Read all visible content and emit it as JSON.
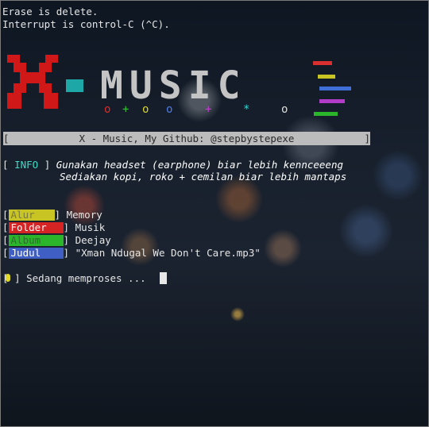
{
  "terminal": {
    "line_erase": "Erase is delete.",
    "line_interrupt": "Interrupt is control-C (^C).",
    "logo_x": "X",
    "logo_word": "MUSIC",
    "logo_dots": [
      "o",
      "+",
      "o",
      "o",
      "+",
      "*",
      "o"
    ],
    "banner_open": "[",
    "banner_text": "X - Music, My Github: @stepbystepexe",
    "banner_close": "]",
    "info_open": "[",
    "info_label": "INFO",
    "info_close": "]",
    "info_line1": "Gunakan headset (earphone) biar lebih kennceeeng",
    "info_line2": "Sediakan kopi, roko + cemilan biar lebih mantaps",
    "rows": [
      {
        "label": "Alur",
        "value": "Memory",
        "color": "#c8c424",
        "text_color": "#7a7a3a"
      },
      {
        "label": "Folder",
        "value": "Musik",
        "color": "#d62424",
        "text_color": "#ffffff"
      },
      {
        "label": "Album",
        "value": "Deejay",
        "color": "#2bb52b",
        "text_color": "#2d6b2d"
      },
      {
        "label": "Judul",
        "value": "\"Xman Ndugal We Don't Care.mp3\"",
        "color": "#3f5fc4",
        "text_color": "#ffffff"
      }
    ],
    "status_open": "[",
    "status_close": "]",
    "status_text": "Sedang memproses ..."
  },
  "colors": {
    "logo_red": "#d01818",
    "logo_teal": "#1ea7a7",
    "logo_gray": "#c4c4c4",
    "info_cyan": "#3fdcc8",
    "status_yellow": "#e1d92a"
  }
}
